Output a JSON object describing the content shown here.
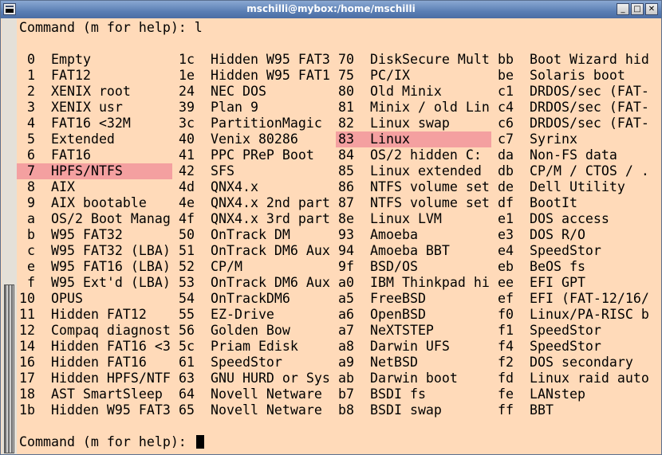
{
  "window": {
    "title": "mschilli@mybox:/home/mschilli"
  },
  "titlebar_buttons": [
    "_",
    "□",
    "✕"
  ],
  "terminal": {
    "command_line_1": "Command (m for help): l",
    "command_line_2": "Command (m for help): ",
    "highlight_color": "#f4a0a0",
    "background": "#ffdab9"
  },
  "partition_columns": [
    [
      {
        "code": "0",
        "name": "Empty"
      },
      {
        "code": "1",
        "name": "FAT12"
      },
      {
        "code": "2",
        "name": "XENIX root"
      },
      {
        "code": "3",
        "name": "XENIX usr"
      },
      {
        "code": "4",
        "name": "FAT16 <32M"
      },
      {
        "code": "5",
        "name": "Extended"
      },
      {
        "code": "6",
        "name": "FAT16"
      },
      {
        "code": "7",
        "name": "HPFS/NTFS"
      },
      {
        "code": "8",
        "name": "AIX"
      },
      {
        "code": "9",
        "name": "AIX bootable"
      },
      {
        "code": "a",
        "name": "OS/2 Boot Manag"
      },
      {
        "code": "b",
        "name": "W95 FAT32"
      },
      {
        "code": "c",
        "name": "W95 FAT32 (LBA)"
      },
      {
        "code": "e",
        "name": "W95 FAT16 (LBA)"
      },
      {
        "code": "f",
        "name": "W95 Ext'd (LBA)"
      },
      {
        "code": "10",
        "name": "OPUS"
      },
      {
        "code": "11",
        "name": "Hidden FAT12"
      },
      {
        "code": "12",
        "name": "Compaq diagnost"
      },
      {
        "code": "14",
        "name": "Hidden FAT16 <3"
      },
      {
        "code": "16",
        "name": "Hidden FAT16"
      },
      {
        "code": "17",
        "name": "Hidden HPFS/NTF"
      },
      {
        "code": "18",
        "name": "AST SmartSleep"
      },
      {
        "code": "1b",
        "name": "Hidden W95 FAT3"
      }
    ],
    [
      {
        "code": "1c",
        "name": "Hidden W95 FAT3"
      },
      {
        "code": "1e",
        "name": "Hidden W95 FAT1"
      },
      {
        "code": "24",
        "name": "NEC DOS"
      },
      {
        "code": "39",
        "name": "Plan 9"
      },
      {
        "code": "3c",
        "name": "PartitionMagic"
      },
      {
        "code": "40",
        "name": "Venix 80286"
      },
      {
        "code": "41",
        "name": "PPC PReP Boot"
      },
      {
        "code": "42",
        "name": "SFS"
      },
      {
        "code": "4d",
        "name": "QNX4.x"
      },
      {
        "code": "4e",
        "name": "QNX4.x 2nd part"
      },
      {
        "code": "4f",
        "name": "QNX4.x 3rd part"
      },
      {
        "code": "50",
        "name": "OnTrack DM"
      },
      {
        "code": "51",
        "name": "OnTrack DM6 Aux"
      },
      {
        "code": "52",
        "name": "CP/M"
      },
      {
        "code": "53",
        "name": "OnTrack DM6 Aux"
      },
      {
        "code": "54",
        "name": "OnTrackDM6"
      },
      {
        "code": "55",
        "name": "EZ-Drive"
      },
      {
        "code": "56",
        "name": "Golden Bow"
      },
      {
        "code": "5c",
        "name": "Priam Edisk"
      },
      {
        "code": "61",
        "name": "SpeedStor"
      },
      {
        "code": "63",
        "name": "GNU HURD or Sys"
      },
      {
        "code": "64",
        "name": "Novell Netware"
      },
      {
        "code": "65",
        "name": "Novell Netware"
      }
    ],
    [
      {
        "code": "70",
        "name": "DiskSecure Mult"
      },
      {
        "code": "75",
        "name": "PC/IX"
      },
      {
        "code": "80",
        "name": "Old Minix"
      },
      {
        "code": "81",
        "name": "Minix / old Lin"
      },
      {
        "code": "82",
        "name": "Linux swap"
      },
      {
        "code": "83",
        "name": "Linux"
      },
      {
        "code": "84",
        "name": "OS/2 hidden C:"
      },
      {
        "code": "85",
        "name": "Linux extended"
      },
      {
        "code": "86",
        "name": "NTFS volume set"
      },
      {
        "code": "87",
        "name": "NTFS volume set"
      },
      {
        "code": "8e",
        "name": "Linux LVM"
      },
      {
        "code": "93",
        "name": "Amoeba"
      },
      {
        "code": "94",
        "name": "Amoeba BBT"
      },
      {
        "code": "9f",
        "name": "BSD/OS"
      },
      {
        "code": "a0",
        "name": "IBM Thinkpad hi"
      },
      {
        "code": "a5",
        "name": "FreeBSD"
      },
      {
        "code": "a6",
        "name": "OpenBSD"
      },
      {
        "code": "a7",
        "name": "NeXTSTEP"
      },
      {
        "code": "a8",
        "name": "Darwin UFS"
      },
      {
        "code": "a9",
        "name": "NetBSD"
      },
      {
        "code": "ab",
        "name": "Darwin boot"
      },
      {
        "code": "b7",
        "name": "BSDI fs"
      },
      {
        "code": "b8",
        "name": "BSDI swap"
      }
    ],
    [
      {
        "code": "bb",
        "name": "Boot Wizard hid"
      },
      {
        "code": "be",
        "name": "Solaris boot"
      },
      {
        "code": "c1",
        "name": "DRDOS/sec (FAT-"
      },
      {
        "code": "c4",
        "name": "DRDOS/sec (FAT-"
      },
      {
        "code": "c6",
        "name": "DRDOS/sec (FAT-"
      },
      {
        "code": "c7",
        "name": "Syrinx"
      },
      {
        "code": "da",
        "name": "Non-FS data"
      },
      {
        "code": "db",
        "name": "CP/M / CTOS / ."
      },
      {
        "code": "de",
        "name": "Dell Utility"
      },
      {
        "code": "df",
        "name": "BootIt"
      },
      {
        "code": "e1",
        "name": "DOS access"
      },
      {
        "code": "e3",
        "name": "DOS R/O"
      },
      {
        "code": "e4",
        "name": "SpeedStor"
      },
      {
        "code": "eb",
        "name": "BeOS fs"
      },
      {
        "code": "ee",
        "name": "EFI GPT"
      },
      {
        "code": "ef",
        "name": "EFI (FAT-12/16/"
      },
      {
        "code": "f0",
        "name": "Linux/PA-RISC b"
      },
      {
        "code": "f1",
        "name": "SpeedStor"
      },
      {
        "code": "f4",
        "name": "SpeedStor"
      },
      {
        "code": "f2",
        "name": "DOS secondary"
      },
      {
        "code": "fd",
        "name": "Linux raid auto"
      },
      {
        "code": "fe",
        "name": "LANstep"
      },
      {
        "code": "ff",
        "name": "BBT"
      }
    ]
  ],
  "highlighted": [
    "7",
    "83"
  ]
}
